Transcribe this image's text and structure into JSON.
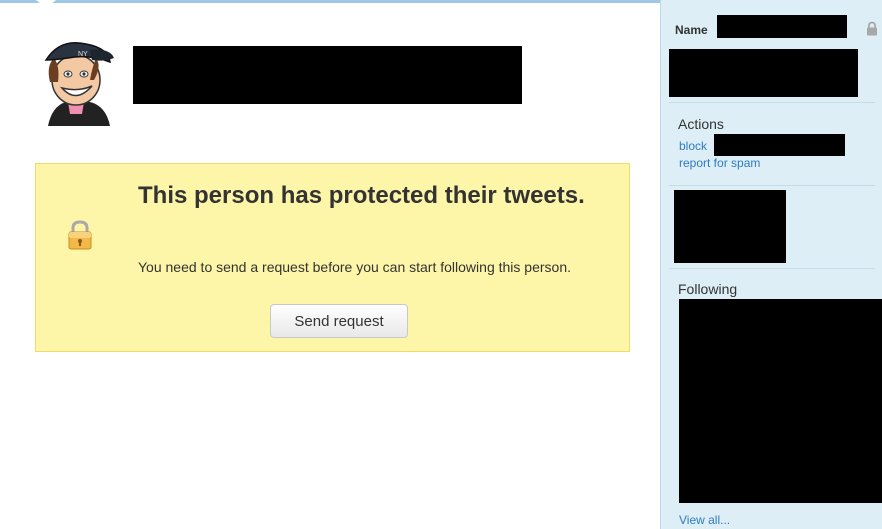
{
  "profile": {
    "avatar_icon": "cartoon-avatar-icon",
    "protected_title": "This person has protected their tweets.",
    "protected_message": "You need to send a request before you can start following this person.",
    "send_request_label": "Send request",
    "lock_icon": "padlock-icon"
  },
  "sidebar": {
    "name_label": "Name",
    "actions_heading": "Actions",
    "block_label": "block",
    "report_spam_label": "report for spam",
    "following_heading": "Following",
    "view_all_label": "View all..."
  },
  "colors": {
    "notice_bg": "#fdf5a7",
    "notice_border": "#eedc6d",
    "sidebar_bg": "#ddeef6",
    "link": "#2f7bbf"
  }
}
